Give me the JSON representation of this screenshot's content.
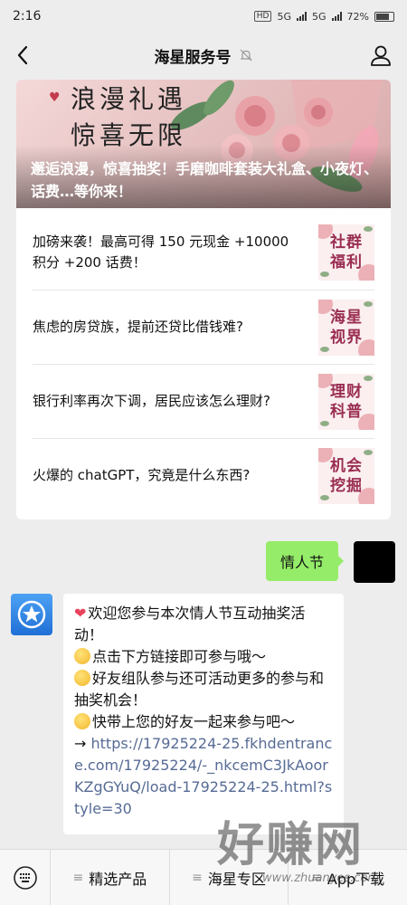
{
  "status": {
    "time": "2:16",
    "hd": "HD",
    "net1": "5G",
    "net2": "5G",
    "battery": "72%"
  },
  "header": {
    "title": "海星服务号"
  },
  "hero": {
    "slogan_line1": "浪漫礼遇",
    "slogan_line2": "惊喜无限",
    "caption": "邂逅浪漫，惊喜抽奖！手磨咖啡套装大礼盒、小夜灯、话费…等你来！"
  },
  "articles": [
    {
      "title": "加磅来袭！最高可得 150 元现金 +10000 积分 +200 话费！",
      "thumb": "社群福利"
    },
    {
      "title": "焦虑的房贷族，提前还贷比借钱难?",
      "thumb": "海星视界"
    },
    {
      "title": "银行利率再次下调，居民应该怎么理财?",
      "thumb": "理财科普"
    },
    {
      "title": "火爆的 chatGPT，究竟是什么东西?",
      "thumb": "机会挖掘"
    }
  ],
  "messages": {
    "sent_text": "情人节",
    "line1": "欢迎您参与本次情人节互动抽奖活动！",
    "line2": "点击下方链接即可参与哦～",
    "line3": "好友组队参与还可活动更多的参与和抽奖机会！",
    "line4": "快带上您的好友一起来参与吧～",
    "arrow": "→",
    "link": "https://17925224-25.fkhdentrance.com/17925224/-_nkcemC3JkAoorKZgGYuQ/load-17925224-25.html?style=30"
  },
  "menu": {
    "item1": "精选产品",
    "item2": "海星专区",
    "item3": "App下载"
  },
  "watermark": {
    "big": "好赚网",
    "small": "www.zhuanyes.com"
  }
}
